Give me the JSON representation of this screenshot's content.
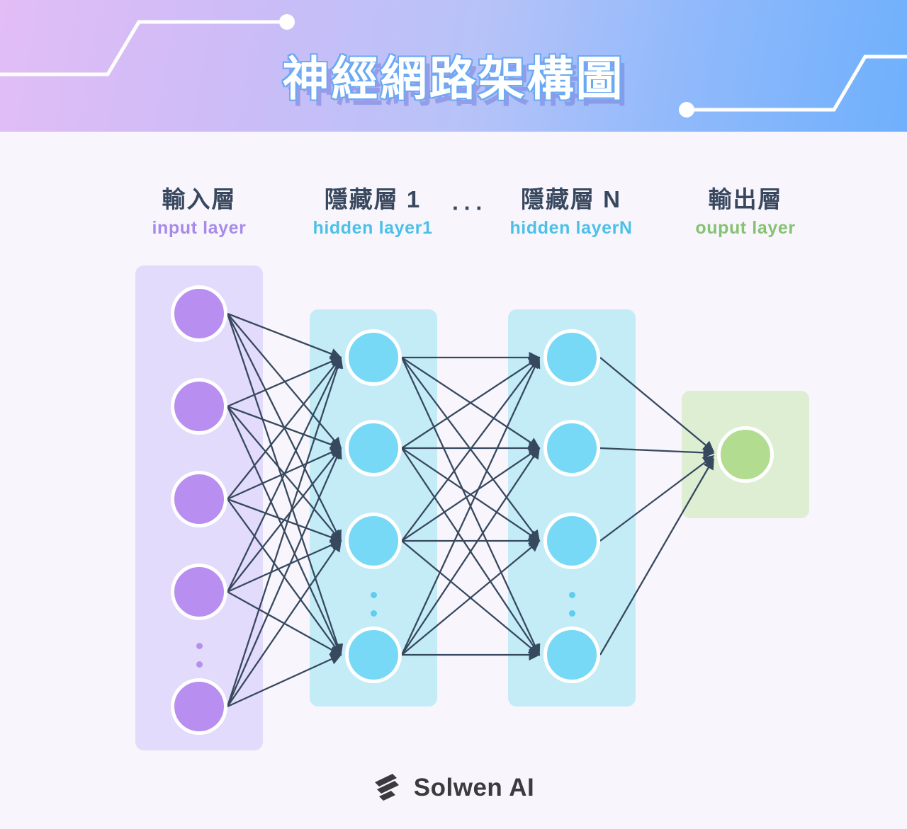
{
  "header": {
    "title": "神經網路架構圖",
    "gradient_from": "#e2bdf6",
    "gradient_to": "#6fb0fc",
    "title_color": "#ffffff",
    "title_outline_color": "#6aa9f4",
    "deco_line_color": "#ffffff"
  },
  "columns": [
    {
      "cn": "輸入層",
      "en": "input layer",
      "en_color": "#a78bea",
      "panel_color": "#e2dbfb",
      "node_color": "#b88ef0"
    },
    {
      "cn": "隱藏層 1",
      "en": "hidden layer1",
      "en_color": "#4bc0e8",
      "panel_color": "#c4ecf7",
      "node_color": "#78d9f7"
    },
    {
      "cn": "隱藏層 N",
      "en": "hidden layerN",
      "en_color": "#4bc0e8",
      "panel_color": "#c4ecf7",
      "node_color": "#78d9f7"
    },
    {
      "cn": "輸出層",
      "en": "ouput layer",
      "en_color": "#86c273",
      "panel_color": "#ddeed3",
      "node_color": "#b2dd91"
    }
  ],
  "label_ellipsis": "···",
  "diagram": {
    "edge_color": "#37495f",
    "node_border_color": "#ffffff",
    "input_node_count": 5,
    "hidden_node_count": 4,
    "output_node_count": 1,
    "input_continuation_dots": "···",
    "hidden_continuation_dots": "···",
    "background": "#f8f6fc"
  },
  "footer": {
    "brand": "Solwen AI",
    "brand_color": "#3b3b3f",
    "logo": "solwen-bolt-logo"
  }
}
